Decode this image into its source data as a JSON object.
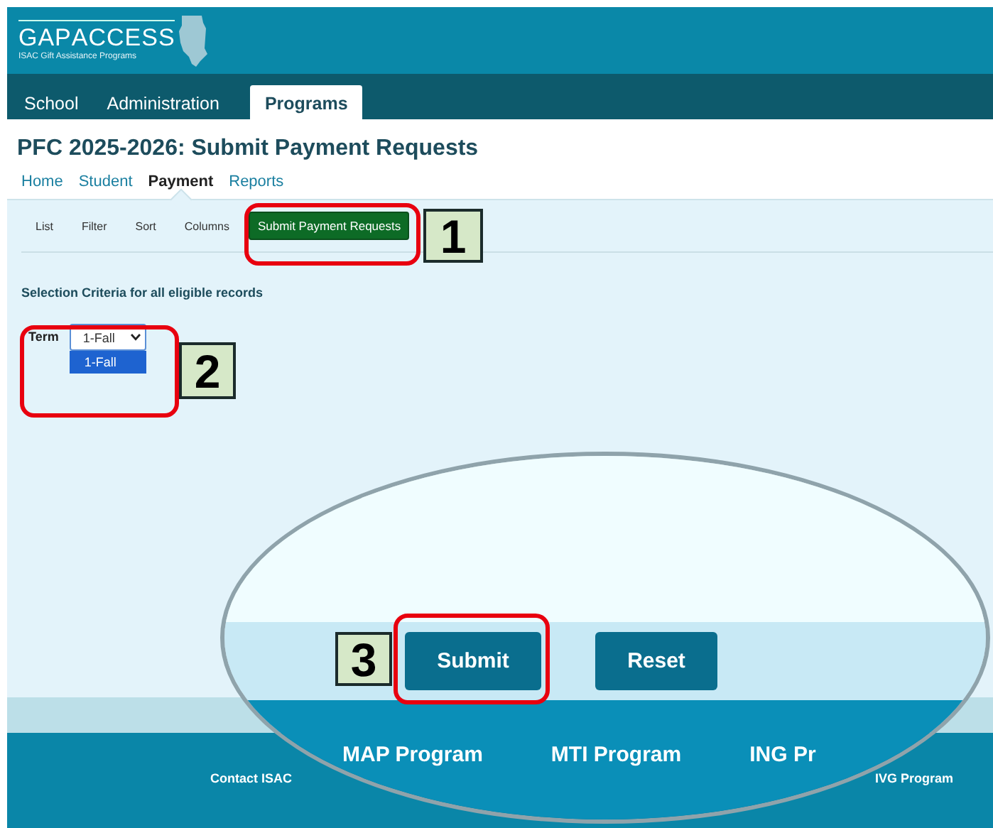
{
  "header": {
    "logo": "**GAP**ACCESS",
    "tagline": "ISAC Gift Assistance Programs"
  },
  "top_tabs": [
    {
      "label": "School",
      "selected": false
    },
    {
      "label": "Administration",
      "selected": false
    },
    {
      "label": "Programs",
      "selected": true
    }
  ],
  "page_title": "PFC 2025-2026: Submit Payment Requests",
  "sub_tabs": [
    {
      "label": "Home",
      "selected": false
    },
    {
      "label": "Student",
      "selected": false
    },
    {
      "label": "Payment",
      "selected": true
    },
    {
      "label": "Reports",
      "selected": false
    }
  ],
  "toolbar": {
    "links": [
      "List",
      "Filter",
      "Sort",
      "Columns"
    ],
    "action": "Submit Payment Requests"
  },
  "criteria_heading": "Selection Criteria for all eligible records",
  "term": {
    "label": "Term",
    "value": "1-Fall",
    "expanded": true,
    "options": [
      {
        "label": "1-Fall",
        "selected": true
      }
    ]
  },
  "footer": {
    "links": [
      "Contact ISAC",
      "IVG Program"
    ]
  },
  "magnifier": {
    "buttons": [
      "Submit",
      "Reset"
    ],
    "program_links": [
      "MAP Program",
      "MTI Program",
      "ING Pr"
    ]
  },
  "callouts": [
    "1",
    "2",
    "3"
  ]
}
